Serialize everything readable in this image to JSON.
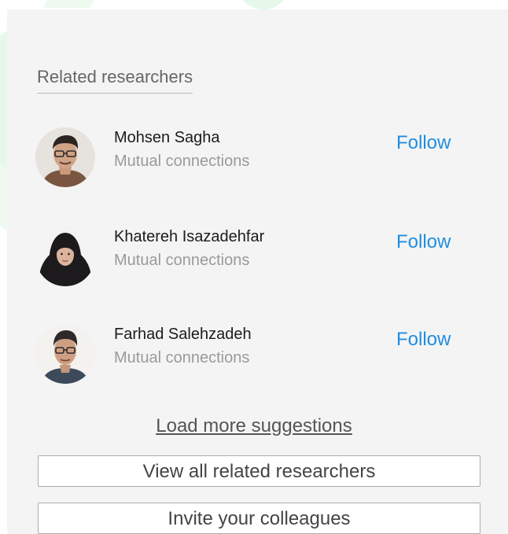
{
  "section": {
    "title": "Related researchers"
  },
  "researchers": [
    {
      "name": "Mohsen Sagha",
      "subtitle": "Mutual connections",
      "follow_label": "Follow",
      "avatar_icon": "profile-photo-man-glasses"
    },
    {
      "name": "Khatereh Isazadehfar",
      "subtitle": "Mutual connections",
      "follow_label": "Follow",
      "avatar_icon": "profile-photo-woman-hijab"
    },
    {
      "name": "Farhad Salehzadeh",
      "subtitle": "Mutual connections",
      "follow_label": "Follow",
      "avatar_icon": "profile-photo-man-glasses"
    }
  ],
  "actions": {
    "load_more_label": "Load more suggestions",
    "view_all_label": "View all related researchers",
    "invite_label": "Invite your colleagues"
  },
  "colors": {
    "follow_link": "#1f8ee0",
    "card_background": "#f4f4f4",
    "decor_green": "#e6f8e9"
  }
}
